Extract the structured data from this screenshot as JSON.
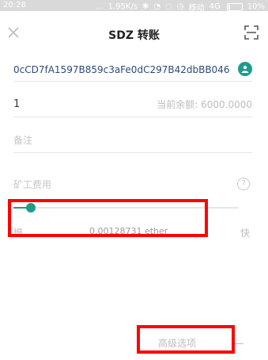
{
  "status_bar": {
    "time": "20:28",
    "dots": "...",
    "net_speed": "1.95K/s",
    "carrier": "移动",
    "network": "4G",
    "battery": "10%"
  },
  "header": {
    "title": "SDZ 转账"
  },
  "form": {
    "address": "0cCD7fA1597B859c3aFe0dC297B42dbBB046",
    "amount": "1",
    "balance_label": "当前余额: 6000.0000",
    "note_placeholder": "备注",
    "fee_label": "矿工费用",
    "help_symbol": "?",
    "slow_label": "慢",
    "fast_label": "快",
    "fee_value": "0.00128731 ether",
    "advanced_label": "高级选项"
  },
  "colors": {
    "accent": "#1f9b8c",
    "highlight": "#ff0000"
  }
}
